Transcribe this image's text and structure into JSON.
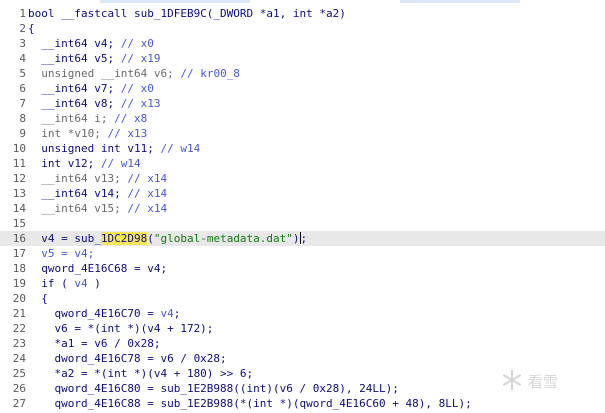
{
  "tab_strip_colors": [
    "#ffffff",
    "#d8e6f5",
    "#ffffff",
    "#d8e6f5",
    "#ffffff"
  ],
  "watermark": {
    "icon": "snowflake-logo-icon",
    "text": "看雪"
  },
  "lines": [
    {
      "n": "1",
      "segs": [
        {
          "t": "bool __fastcall sub_1DFEB9C(_DWORD *a1, int *a2)",
          "c": "kw"
        }
      ]
    },
    {
      "n": "2",
      "segs": [
        {
          "t": "{",
          "c": "kw"
        }
      ]
    },
    {
      "n": "3",
      "segs": [
        {
          "t": "  __int64 v4; ",
          "c": "kw"
        },
        {
          "t": "// x0",
          "c": "cm"
        }
      ]
    },
    {
      "n": "4",
      "segs": [
        {
          "t": "  __int64 v5; ",
          "c": "kw"
        },
        {
          "t": "// x19",
          "c": "cm"
        }
      ]
    },
    {
      "n": "5",
      "segs": [
        {
          "t": "  unsigned __int64 v6; ",
          "c": "dim"
        },
        {
          "t": "// kr00_8",
          "c": "cm"
        }
      ]
    },
    {
      "n": "6",
      "segs": [
        {
          "t": "  __int64 v7; ",
          "c": "kw"
        },
        {
          "t": "// x0",
          "c": "cm"
        }
      ]
    },
    {
      "n": "7",
      "segs": [
        {
          "t": "  __int64 v8; ",
          "c": "kw"
        },
        {
          "t": "// x13",
          "c": "cm"
        }
      ]
    },
    {
      "n": "8",
      "segs": [
        {
          "t": "  __int64 i; ",
          "c": "dim"
        },
        {
          "t": "// x8",
          "c": "cm"
        }
      ]
    },
    {
      "n": "9",
      "segs": [
        {
          "t": "  int *v10; ",
          "c": "dim"
        },
        {
          "t": "// x13",
          "c": "cm"
        }
      ]
    },
    {
      "n": "10",
      "segs": [
        {
          "t": "  unsigned int v11; ",
          "c": "kw"
        },
        {
          "t": "// w14",
          "c": "cm"
        }
      ]
    },
    {
      "n": "11",
      "segs": [
        {
          "t": "  int v12; ",
          "c": "kw"
        },
        {
          "t": "// w14",
          "c": "cm"
        }
      ]
    },
    {
      "n": "12",
      "segs": [
        {
          "t": "  __int64 v13; ",
          "c": "dim"
        },
        {
          "t": "// x14",
          "c": "cm"
        }
      ]
    },
    {
      "n": "13",
      "segs": [
        {
          "t": "  __int64 v14; ",
          "c": "kw"
        },
        {
          "t": "// x14",
          "c": "cm"
        }
      ]
    },
    {
      "n": "14",
      "segs": [
        {
          "t": "  __int64 v15; ",
          "c": "dim"
        },
        {
          "t": "// x14",
          "c": "cm"
        }
      ]
    },
    {
      "n": "15",
      "segs": []
    },
    {
      "n": "16",
      "hl": true,
      "segs": [
        {
          "t": "  v4 = sub_",
          "c": "kw"
        },
        {
          "t": "1DC2D98",
          "c": "hlword"
        },
        {
          "t": "(",
          "c": "kw"
        },
        {
          "t": "\"global-metadata.dat\"",
          "c": "str"
        },
        {
          "t": ")",
          "c": "kw"
        },
        {
          "t": "",
          "c": "cursor"
        },
        {
          "t": ";",
          "c": "kw"
        }
      ]
    },
    {
      "n": "17",
      "segs": [
        {
          "t": "  v5 = v4;",
          "c": "cm"
        }
      ]
    },
    {
      "n": "18",
      "segs": [
        {
          "t": "  qword_4E16C68 = v4;",
          "c": "kw"
        }
      ]
    },
    {
      "n": "19",
      "segs": [
        {
          "t": "  if ( ",
          "c": "kw"
        },
        {
          "t": "v4",
          "c": "cm"
        },
        {
          "t": " )",
          "c": "kw"
        }
      ]
    },
    {
      "n": "20",
      "segs": [
        {
          "t": "  {",
          "c": "kw"
        }
      ]
    },
    {
      "n": "21",
      "segs": [
        {
          "t": "    qword_4E16C70 = ",
          "c": "kw"
        },
        {
          "t": "v4",
          "c": "cm"
        },
        {
          "t": ";",
          "c": "kw"
        }
      ]
    },
    {
      "n": "22",
      "segs": [
        {
          "t": "    v6 = *(int *)(v4 + 172);",
          "c": "kw"
        }
      ]
    },
    {
      "n": "23",
      "segs": [
        {
          "t": "    *a1 = v6 / 0x28;",
          "c": "kw"
        }
      ]
    },
    {
      "n": "24",
      "segs": [
        {
          "t": "    dword_4E16C78 = v6 / 0x28;",
          "c": "kw"
        }
      ]
    },
    {
      "n": "25",
      "segs": [
        {
          "t": "    *a2 = *(int *)(v4 + 180) >> 6;",
          "c": "kw"
        }
      ]
    },
    {
      "n": "26",
      "segs": [
        {
          "t": "    qword_4E16C80 = sub_1E2B988((int)(v6 / 0x28), 24LL);",
          "c": "kw"
        }
      ]
    },
    {
      "n": "27",
      "segs": [
        {
          "t": "    qword_4E16C88 = sub_1E2B988(*(int *)(qword_4E16C60 + 48), 8LL);",
          "c": "kw"
        }
      ]
    }
  ]
}
